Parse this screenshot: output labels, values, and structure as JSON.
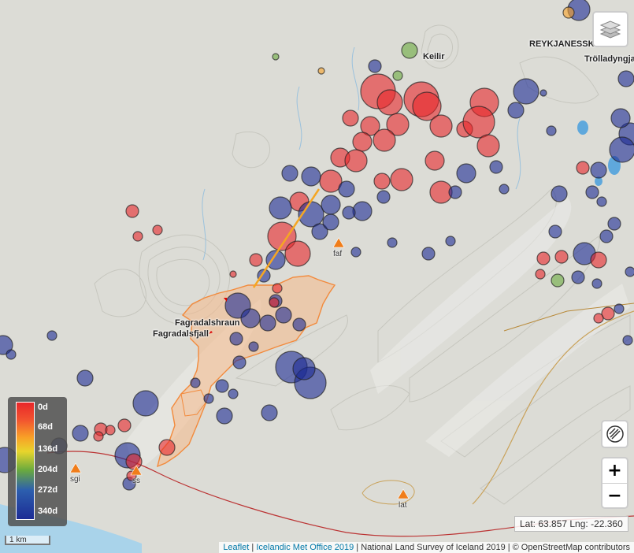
{
  "places": {
    "keilir": "Keilir",
    "reykjanesskagi": "REYKJANESSKA",
    "trolladyngja": "Trölladyngja",
    "fagradalshraun": "Fagradalshraun",
    "fagradalsfjall": "Fagradalsfjall"
  },
  "stations": {
    "faf": "faf",
    "sgi": "sgi",
    "ss": "ss",
    "lat": "lat"
  },
  "legend": {
    "ticks": [
      "0d",
      "68d",
      "136d",
      "204d",
      "272d",
      "340d"
    ]
  },
  "colors": {
    "recent": "#e8262a",
    "mid": "#f8a127",
    "green": "#6aaa3e",
    "old": "#1c2c95",
    "lava": "#f28a3c",
    "dike": "#f5a623",
    "station": "#f07d1a",
    "water": "#5fa8dc"
  },
  "icons": {
    "layers": "layers-icon",
    "draw": "draw-polygon-icon"
  },
  "controls": {
    "zoom_in": "+",
    "zoom_out": "−"
  },
  "coords": "Lat: 63.857 Lng: -22.360",
  "scale": "1 km",
  "attribution": {
    "leaflet": "Leaflet",
    "sep1": " | ",
    "imo": "Icelandic Met Office 2019",
    "rest": " | National Land Survey of Iceland 2019 | © OpenStreetMap contributors"
  }
}
